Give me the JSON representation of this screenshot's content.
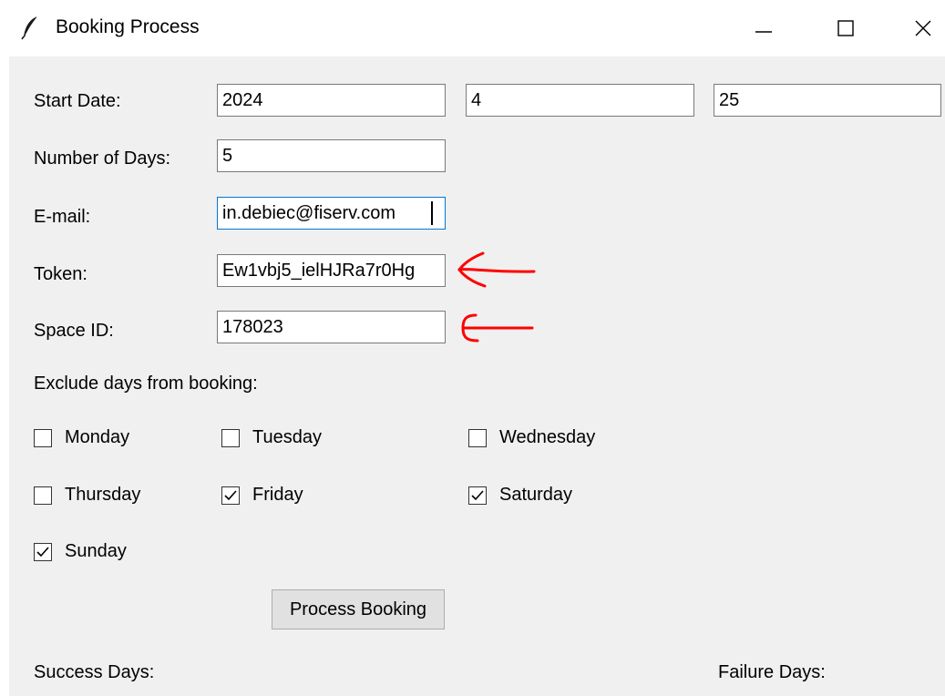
{
  "window": {
    "title": "Booking Process",
    "icon": "feather-icon",
    "controls": [
      "minimize-icon",
      "maximize-icon",
      "close-icon"
    ]
  },
  "form": {
    "start_date": {
      "label": "Start Date:",
      "year": "2024",
      "month": "4",
      "day": "25"
    },
    "num_days": {
      "label": "Number of Days:",
      "value": "5"
    },
    "email": {
      "label": "E-mail:",
      "value": "in.debiec@fiserv.com"
    },
    "token": {
      "label": "Token:",
      "value": "Ew1vbj5_ielHJRa7r0Hg"
    },
    "space_id": {
      "label": "Space ID:",
      "value": "178023"
    }
  },
  "exclude": {
    "label": "Exclude days from booking:",
    "days": [
      {
        "label": "Monday",
        "checked": false
      },
      {
        "label": "Tuesday",
        "checked": false
      },
      {
        "label": "Wednesday",
        "checked": false
      },
      {
        "label": "Thursday",
        "checked": false
      },
      {
        "label": "Friday",
        "checked": true
      },
      {
        "label": "Saturday",
        "checked": true
      },
      {
        "label": "Sunday",
        "checked": true
      }
    ]
  },
  "actions": {
    "process_label": "Process Booking"
  },
  "results": {
    "success_label": "Success Days:",
    "failure_label": "Failure Days:"
  },
  "annotations": {
    "arrow_color": "#ff0000"
  }
}
